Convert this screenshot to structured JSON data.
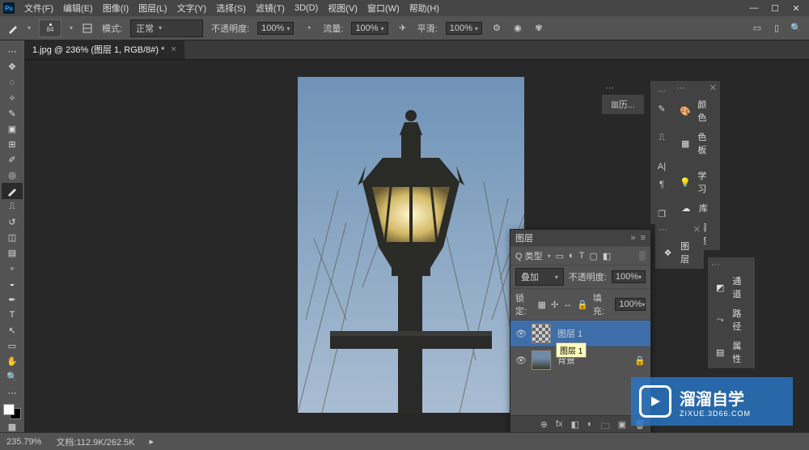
{
  "menu": {
    "file": "文件(F)",
    "edit": "编辑(E)",
    "image": "图像(I)",
    "layer": "图层(L)",
    "type": "文字(Y)",
    "select": "选择(S)",
    "filter": "滤镜(T)",
    "threed": "3D(D)",
    "view": "视图(V)",
    "window": "窗口(W)",
    "help": "帮助(H)"
  },
  "options": {
    "brush_size": "84",
    "mode_label": "模式:",
    "mode_value": "正常",
    "opacity_label": "不透明度:",
    "opacity_value": "100%",
    "flow_label": "流量:",
    "flow_value": "100%",
    "smooth_label": "平滑:",
    "smooth_value": "100%"
  },
  "tab": {
    "title": "1.jpg @ 236% (图层 1, RGB/8#) *"
  },
  "layers_panel": {
    "tab_label": "图层",
    "header_icon_label": "图层",
    "filter_label": "类型",
    "blend": "叠加",
    "opacity_label": "不透明度:",
    "opacity_value": "100%",
    "lock_label": "锁定:",
    "fill_label": "填充:",
    "fill_value": "100%",
    "layers": [
      {
        "name": "图层 1",
        "selected": true,
        "locked": false,
        "thumb": "checker"
      },
      {
        "name": "背景",
        "selected": false,
        "locked": true,
        "thumb": "lamp"
      }
    ],
    "tooltip": "图层 1"
  },
  "rhs": {
    "history_label": "历...",
    "color_label": "颜色",
    "swatch_label": "色板",
    "learn_label": "学习",
    "library_label": "库",
    "adjust_label": "调整",
    "channels_label": "通道",
    "paths_label": "路径",
    "props_label": "属性"
  },
  "status": {
    "zoom": "235.79%",
    "doc_label": "文档:",
    "doc_size": "112.9K/262.5K"
  },
  "watermark": {
    "big": "溜溜自学",
    "small": "ZIXUE.3D66.COM"
  },
  "icons": {
    "search": "Q",
    "kind_px": "▭",
    "kind_adj": "◐",
    "kind_txt": "T",
    "kind_shp": "▢",
    "kind_sm": "◧"
  }
}
